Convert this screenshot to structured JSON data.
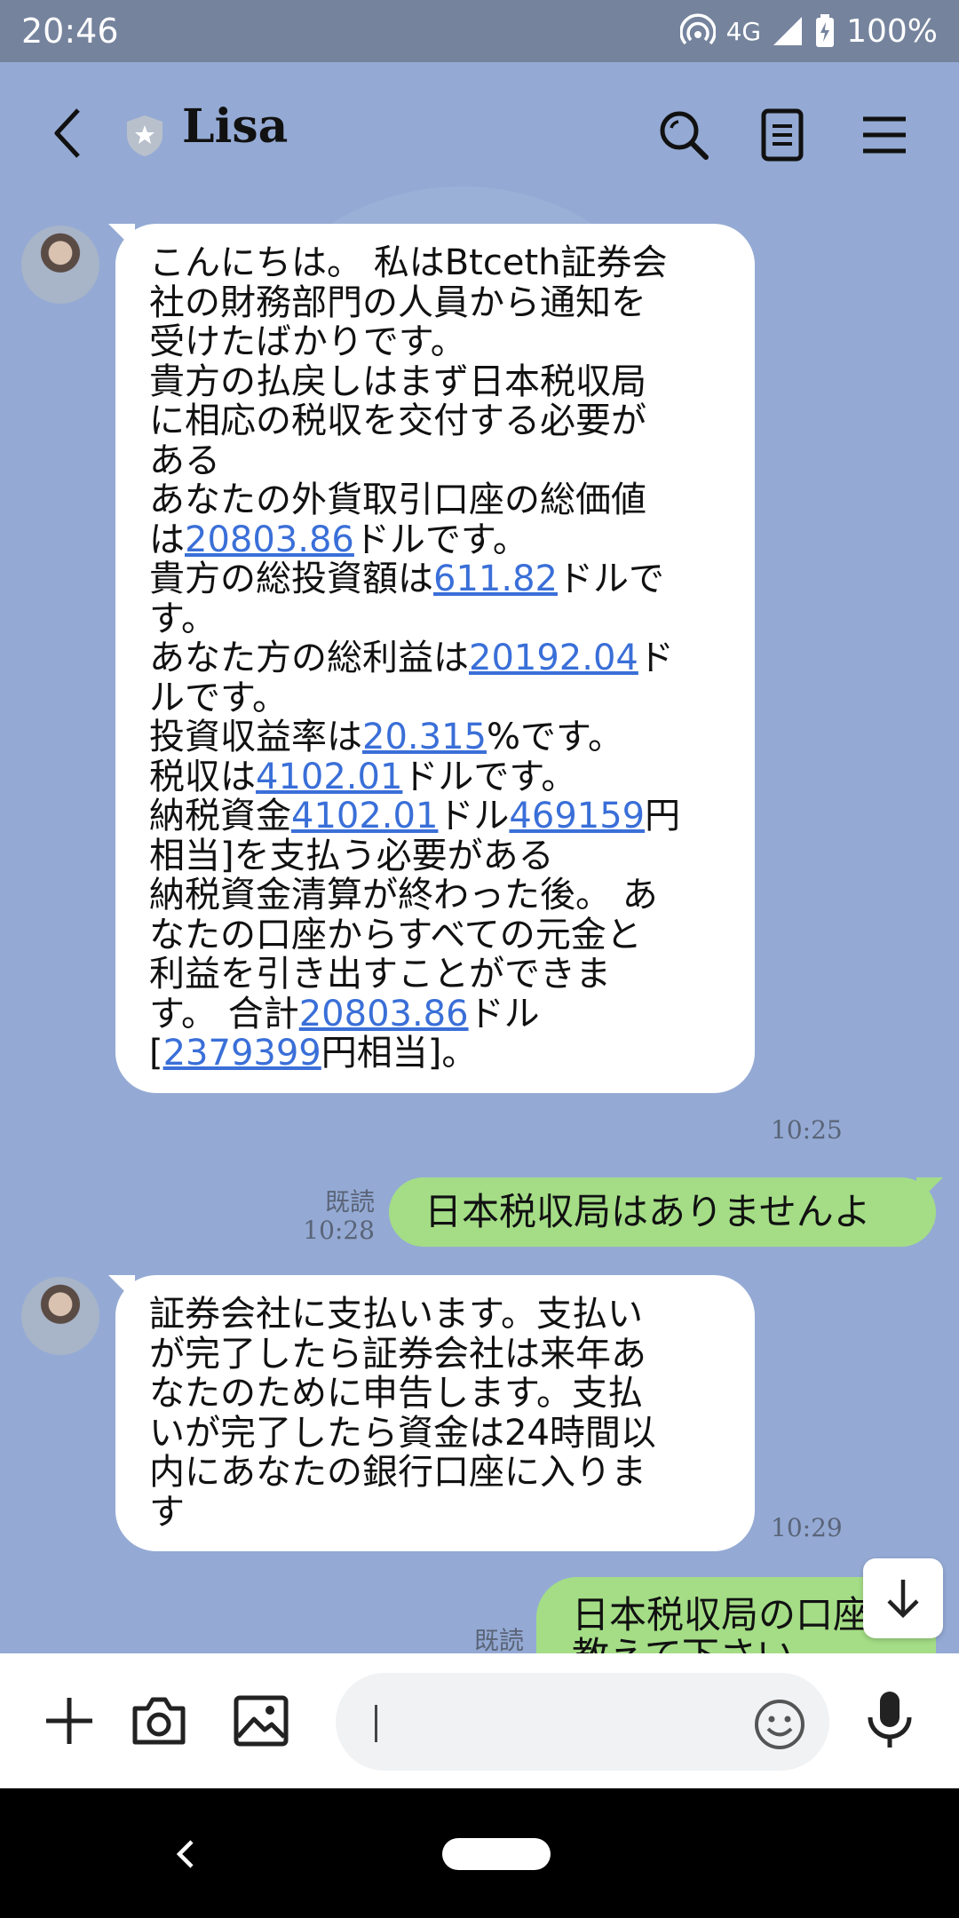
{
  "status_bar": {
    "time": "20:46",
    "network": "4G",
    "battery": "100%"
  },
  "header": {
    "title": "Lisa"
  },
  "messages": {
    "m1": {
      "lines": [
        [
          {
            "t": "こんにちは。 私はBtceth証券会"
          }
        ],
        [
          {
            "t": "社の財務部門の人員から通知を"
          }
        ],
        [
          {
            "t": "受けたばかりです。"
          }
        ],
        [
          {
            "t": "貴方の払戻しはまず日本税収局"
          }
        ],
        [
          {
            "t": "に相応の税収を交付する必要が"
          }
        ],
        [
          {
            "t": "ある"
          }
        ],
        [
          {
            "t": "あなたの外貨取引口座の総価値"
          }
        ],
        [
          {
            "t": "は"
          },
          {
            "t": "20803.86",
            "link": true
          },
          {
            "t": "ドルです。"
          }
        ],
        [
          {
            "t": "貴方の総投資額は"
          },
          {
            "t": "611.82",
            "link": true
          },
          {
            "t": "ドルで"
          }
        ],
        [
          {
            "t": "す。"
          }
        ],
        [
          {
            "t": "あなた方の総利益は"
          },
          {
            "t": "20192.04",
            "link": true
          },
          {
            "t": "ド"
          }
        ],
        [
          {
            "t": "ルです。"
          }
        ],
        [
          {
            "t": "投資収益率は"
          },
          {
            "t": "20.315",
            "link": true
          },
          {
            "t": "%です。"
          }
        ],
        [
          {
            "t": "税収は"
          },
          {
            "t": "4102.01",
            "link": true
          },
          {
            "t": "ドルです。"
          }
        ],
        [
          {
            "t": "納税資金"
          },
          {
            "t": "4102.01",
            "link": true
          },
          {
            "t": "ドル"
          },
          {
            "t": "469159",
            "link": true
          },
          {
            "t": "円"
          }
        ],
        [
          {
            "t": "相当]を支払う必要がある"
          }
        ],
        [
          {
            "t": "納税資金清算が終わった後。 あ"
          }
        ],
        [
          {
            "t": "なたの口座からすべての元金と"
          }
        ],
        [
          {
            "t": "利益を引き出すことができま"
          }
        ],
        [
          {
            "t": "す。 合計"
          },
          {
            "t": "20803.86",
            "link": true
          },
          {
            "t": "ドル"
          }
        ],
        [
          {
            "t": "["
          },
          {
            "t": "2379399",
            "link": true
          },
          {
            "t": "円相当]。"
          }
        ]
      ],
      "time": "10:25"
    },
    "m2": {
      "text": "日本税収局はありませんよ",
      "read": "既読",
      "time": "10:28"
    },
    "m3": {
      "lines": [
        [
          {
            "t": "証券会社に支払います。支払い"
          }
        ],
        [
          {
            "t": "が完了したら証券会社は来年あ"
          }
        ],
        [
          {
            "t": "なたのために申告します。支払"
          }
        ],
        [
          {
            "t": "いが完了したら資金は24時間以"
          }
        ],
        [
          {
            "t": "内にあなたの銀行口座に入りま"
          }
        ],
        [
          {
            "t": "す"
          }
        ]
      ],
      "time": "10:29"
    },
    "m4": {
      "line1": "日本税収局の口座",
      "line2": "教えて下さい",
      "read": "既読"
    }
  },
  "colors": {
    "chat_bg": "#94aad4",
    "outgoing_bubble": "#a4dd86",
    "link": "#3a6fd8"
  },
  "icons": [
    "back-arrow-icon",
    "shield-star-icon",
    "search-icon",
    "notes-icon",
    "menu-icon",
    "plus-icon",
    "camera-icon",
    "image-icon",
    "emoji-icon",
    "mic-icon",
    "arrow-down-icon"
  ]
}
